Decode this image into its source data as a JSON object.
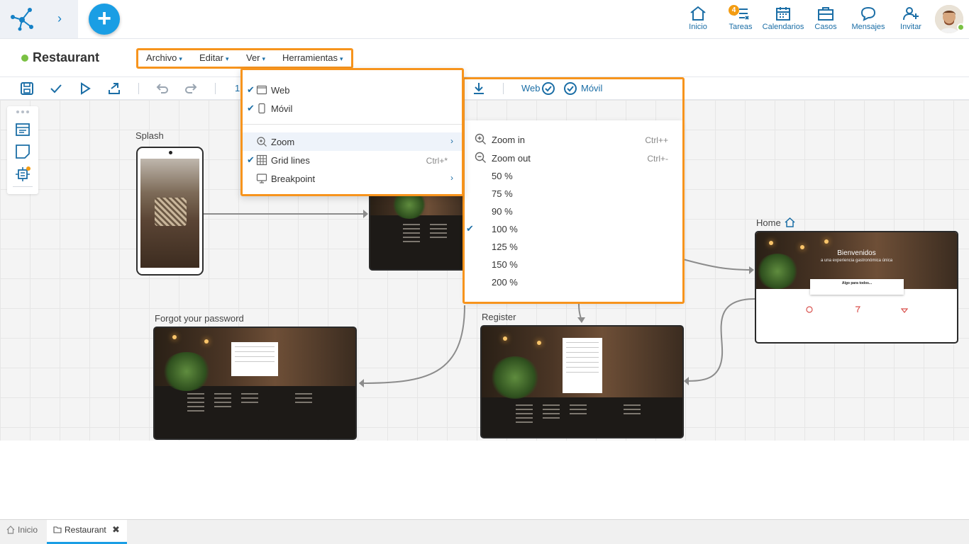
{
  "nav": {
    "items": [
      {
        "label": "Inicio",
        "icon": "home-icon"
      },
      {
        "label": "Tareas",
        "icon": "tasks-icon",
        "badge": "4"
      },
      {
        "label": "Calendarios",
        "icon": "calendar-icon"
      },
      {
        "label": "Casos",
        "icon": "briefcase-icon"
      },
      {
        "label": "Mensajes",
        "icon": "chat-icon"
      },
      {
        "label": "Invitar",
        "icon": "add-user-icon"
      }
    ]
  },
  "page": {
    "title": "Restaurant",
    "status_color": "#7ac143",
    "menu": [
      "Archivo",
      "Editar",
      "Ver",
      "Herramientas"
    ]
  },
  "toolbar": {
    "zoom_partial": "1",
    "web_label": "Web",
    "movil_label": "Móvil"
  },
  "view_menu": {
    "items": [
      {
        "label": "Web",
        "checked": true,
        "icon": "web-icon"
      },
      {
        "label": "Móvil",
        "checked": true,
        "icon": "mobile-icon"
      },
      {
        "label": "Zoom",
        "icon": "zoom-icon",
        "submenu": true
      },
      {
        "label": "Grid lines",
        "checked": true,
        "icon": "grid-icon",
        "shortcut": "Ctrl+*"
      },
      {
        "label": "Breakpoint",
        "icon": "monitor-icon",
        "submenu": true
      }
    ]
  },
  "zoom_menu": {
    "zoom_in": {
      "label": "Zoom in",
      "shortcut": "Ctrl++"
    },
    "zoom_out": {
      "label": "Zoom out",
      "shortcut": "Ctrl+-"
    },
    "levels": [
      "50 %",
      "75 %",
      "90 %",
      "100 %",
      "125 %",
      "150 %",
      "200 %"
    ],
    "selected": "100 %"
  },
  "canvas": {
    "nodes": [
      {
        "label": "Splash"
      },
      {
        "label": "Home"
      },
      {
        "label": "Forgot your password"
      },
      {
        "label": "Register"
      }
    ],
    "home_hero_title": "Bienvenidos",
    "home_hero_sub": "a una experiencia gastronómica única",
    "home_box_title": "Algo para todos..."
  },
  "tabs": [
    {
      "label": "Inicio",
      "icon": "home-icon"
    },
    {
      "label": "Restaurant",
      "icon": "folder-icon",
      "closable": true
    }
  ],
  "colors": {
    "accent": "#1a9ee4",
    "highlight_outline": "#f7941d",
    "link": "#1b6ea6"
  }
}
